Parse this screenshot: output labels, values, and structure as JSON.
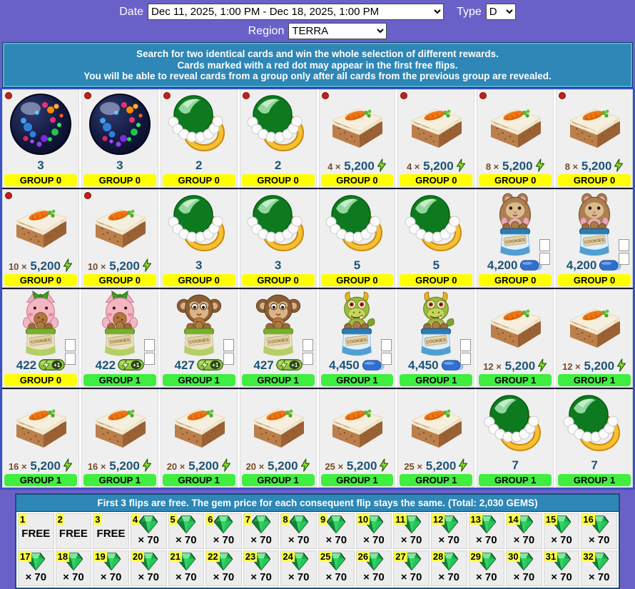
{
  "toolbar": {
    "date_label": "Date",
    "date_value": "Dec 11, 2025, 1:00 PM - Dec 18, 2025, 1:00 PM",
    "type_label": "Type",
    "type_value": "D",
    "region_label": "Region",
    "region_value": "TERRA"
  },
  "info_banner": {
    "line1": "Search for two identical cards and win the whole selection of different rewards.",
    "line2": "Cards marked with a red dot may appear in the first free flips.",
    "line3": "You will be able to reveal cards from a group only after all cards from the previous group are revealed."
  },
  "colors": {
    "page_bg": "#6A61C8",
    "banner_blue": "#2E87B6",
    "group0": "#FFFF00",
    "group1": "#3FEE3F",
    "value_text": "#1D5377",
    "red_dot": "#C32017",
    "flip_number_bg": "#FFFF44",
    "gem_green": "#1DA84A"
  },
  "group_labels": {
    "group0": "GROUP 0",
    "group1": "GROUP 1"
  },
  "cards": [
    {
      "image": "mystery-orb",
      "prefix": "",
      "value": "3",
      "icon": "none",
      "group": "GROUP 0",
      "red_dot": true,
      "spinner": false
    },
    {
      "image": "mystery-orb",
      "prefix": "",
      "value": "3",
      "icon": "none",
      "group": "GROUP 0",
      "red_dot": true,
      "spinner": false
    },
    {
      "image": "pearl-ring",
      "prefix": "",
      "value": "2",
      "icon": "none",
      "group": "GROUP 0",
      "red_dot": true,
      "spinner": false
    },
    {
      "image": "pearl-ring",
      "prefix": "",
      "value": "2",
      "icon": "none",
      "group": "GROUP 0",
      "red_dot": true,
      "spinner": false
    },
    {
      "image": "carrot-cake",
      "prefix": "4 ×",
      "value": "5,200",
      "icon": "energy-bolt",
      "group": "GROUP 0",
      "red_dot": true,
      "spinner": false
    },
    {
      "image": "carrot-cake",
      "prefix": "4 ×",
      "value": "5,200",
      "icon": "energy-bolt",
      "group": "GROUP 0",
      "red_dot": true,
      "spinner": false
    },
    {
      "image": "carrot-cake",
      "prefix": "8 ×",
      "value": "5,200",
      "icon": "energy-bolt",
      "group": "GROUP 0",
      "red_dot": true,
      "spinner": false
    },
    {
      "image": "carrot-cake",
      "prefix": "8 ×",
      "value": "5,200",
      "icon": "energy-bolt",
      "group": "GROUP 0",
      "red_dot": true,
      "spinner": false
    },
    {
      "image": "carrot-cake",
      "prefix": "10 ×",
      "value": "5,200",
      "icon": "energy-bolt",
      "group": "GROUP 0",
      "red_dot": true,
      "spinner": false
    },
    {
      "image": "carrot-cake",
      "prefix": "10 ×",
      "value": "5,200",
      "icon": "energy-bolt",
      "group": "GROUP 0",
      "red_dot": true,
      "spinner": false
    },
    {
      "image": "pearl-ring",
      "prefix": "",
      "value": "3",
      "icon": "none",
      "group": "GROUP 0",
      "red_dot": false,
      "spinner": false
    },
    {
      "image": "pearl-ring",
      "prefix": "",
      "value": "3",
      "icon": "none",
      "group": "GROUP 0",
      "red_dot": false,
      "spinner": false
    },
    {
      "image": "pearl-ring",
      "prefix": "",
      "value": "5",
      "icon": "none",
      "group": "GROUP 0",
      "red_dot": false,
      "spinner": false
    },
    {
      "image": "pearl-ring",
      "prefix": "",
      "value": "5",
      "icon": "none",
      "group": "GROUP 0",
      "red_dot": false,
      "spinner": false
    },
    {
      "image": "hamster-cookie-jar",
      "prefix": "",
      "value": "4,200",
      "icon": "blue-pill",
      "group": "GROUP 0",
      "red_dot": false,
      "spinner": true
    },
    {
      "image": "hamster-cookie-jar",
      "prefix": "",
      "value": "4,200",
      "icon": "blue-pill",
      "group": "GROUP 0",
      "red_dot": false,
      "spinner": true
    },
    {
      "image": "pig-cookie-jar",
      "prefix": "",
      "value": "422",
      "icon": "energy-pill-plus1",
      "group": "GROUP 0",
      "red_dot": false,
      "spinner": true
    },
    {
      "image": "pig-cookie-jar",
      "prefix": "",
      "value": "422",
      "icon": "energy-pill-plus1",
      "group": "GROUP 1",
      "red_dot": false,
      "spinner": true
    },
    {
      "image": "monkey-cookie-jar",
      "prefix": "",
      "value": "427",
      "icon": "energy-pill-plus1",
      "group": "GROUP 1",
      "red_dot": false,
      "spinner": true
    },
    {
      "image": "monkey-cookie-jar",
      "prefix": "",
      "value": "427",
      "icon": "energy-pill-plus1",
      "group": "GROUP 1",
      "red_dot": false,
      "spinner": true
    },
    {
      "image": "dragon-cookie-jar",
      "prefix": "",
      "value": "4,450",
      "icon": "blue-pill",
      "group": "GROUP 1",
      "red_dot": false,
      "spinner": true
    },
    {
      "image": "dragon-cookie-jar",
      "prefix": "",
      "value": "4,450",
      "icon": "blue-pill",
      "group": "GROUP 1",
      "red_dot": false,
      "spinner": true
    },
    {
      "image": "carrot-cake",
      "prefix": "12 ×",
      "value": "5,200",
      "icon": "energy-bolt",
      "group": "GROUP 1",
      "red_dot": false,
      "spinner": false
    },
    {
      "image": "carrot-cake",
      "prefix": "12 ×",
      "value": "5,200",
      "icon": "energy-bolt",
      "group": "GROUP 1",
      "red_dot": false,
      "spinner": false
    },
    {
      "image": "carrot-cake",
      "prefix": "16 ×",
      "value": "5,200",
      "icon": "energy-bolt",
      "group": "GROUP 1",
      "red_dot": false,
      "spinner": false
    },
    {
      "image": "carrot-cake",
      "prefix": "16 ×",
      "value": "5,200",
      "icon": "energy-bolt",
      "group": "GROUP 1",
      "red_dot": false,
      "spinner": false
    },
    {
      "image": "carrot-cake",
      "prefix": "20 ×",
      "value": "5,200",
      "icon": "energy-bolt",
      "group": "GROUP 1",
      "red_dot": false,
      "spinner": false
    },
    {
      "image": "carrot-cake",
      "prefix": "20 ×",
      "value": "5,200",
      "icon": "energy-bolt",
      "group": "GROUP 1",
      "red_dot": false,
      "spinner": false
    },
    {
      "image": "carrot-cake",
      "prefix": "25 ×",
      "value": "5,200",
      "icon": "energy-bolt",
      "group": "GROUP 1",
      "red_dot": false,
      "spinner": false
    },
    {
      "image": "carrot-cake",
      "prefix": "25 ×",
      "value": "5,200",
      "icon": "energy-bolt",
      "group": "GROUP 1",
      "red_dot": false,
      "spinner": false
    },
    {
      "image": "pearl-ring",
      "prefix": "",
      "value": "7",
      "icon": "none",
      "group": "GROUP 1",
      "red_dot": false,
      "spinner": false
    },
    {
      "image": "pearl-ring",
      "prefix": "",
      "value": "7",
      "icon": "none",
      "group": "GROUP 1",
      "red_dot": false,
      "spinner": false
    }
  ],
  "flips_banner": {
    "text": "First 3 flips are free. The gem price for each consequent flip stays the same. (Total: 2,030 GEMS)"
  },
  "flips": [
    {
      "n": "1",
      "label": "FREE"
    },
    {
      "n": "2",
      "label": "FREE"
    },
    {
      "n": "3",
      "label": "FREE"
    },
    {
      "n": "4",
      "label": "× 70"
    },
    {
      "n": "5",
      "label": "× 70"
    },
    {
      "n": "6",
      "label": "× 70"
    },
    {
      "n": "7",
      "label": "× 70"
    },
    {
      "n": "8",
      "label": "× 70"
    },
    {
      "n": "9",
      "label": "× 70"
    },
    {
      "n": "10",
      "label": "× 70"
    },
    {
      "n": "11",
      "label": "× 70"
    },
    {
      "n": "12",
      "label": "× 70"
    },
    {
      "n": "13",
      "label": "× 70"
    },
    {
      "n": "14",
      "label": "× 70"
    },
    {
      "n": "15",
      "label": "× 70"
    },
    {
      "n": "16",
      "label": "× 70"
    },
    {
      "n": "17",
      "label": "× 70"
    },
    {
      "n": "18",
      "label": "× 70"
    },
    {
      "n": "19",
      "label": "× 70"
    },
    {
      "n": "20",
      "label": "× 70"
    },
    {
      "n": "21",
      "label": "× 70"
    },
    {
      "n": "22",
      "label": "× 70"
    },
    {
      "n": "23",
      "label": "× 70"
    },
    {
      "n": "24",
      "label": "× 70"
    },
    {
      "n": "25",
      "label": "× 70"
    },
    {
      "n": "26",
      "label": "× 70"
    },
    {
      "n": "27",
      "label": "× 70"
    },
    {
      "n": "28",
      "label": "× 70"
    },
    {
      "n": "29",
      "label": "× 70"
    },
    {
      "n": "30",
      "label": "× 70"
    },
    {
      "n": "31",
      "label": "× 70"
    },
    {
      "n": "32",
      "label": "× 70"
    }
  ]
}
